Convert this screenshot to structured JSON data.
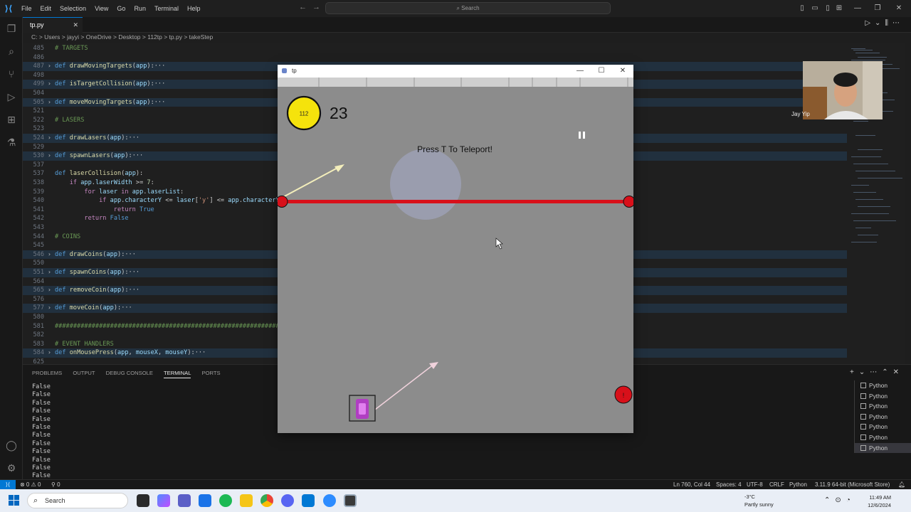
{
  "menu": [
    "File",
    "Edit",
    "Selection",
    "View",
    "Go",
    "Run",
    "Terminal",
    "Help"
  ],
  "search": {
    "label": "Search"
  },
  "tab": {
    "label": "tp.py",
    "close": "✕"
  },
  "breadcrumb": "C: > Users > jayyi > OneDrive > Desktop > 112tp > tp.py > takeStep",
  "code_lines": [
    {
      "ln": "485",
      "html": "<span class='cm'># TARGETS</span>",
      "folded": false
    },
    {
      "ln": "486",
      "html": "",
      "folded": false
    },
    {
      "ln": "487",
      "html": "<span class='kw'>def</span> <span class='fn'>drawMovingTargets</span>(<span class='var'>app</span>):···",
      "folded": true
    },
    {
      "ln": "498",
      "html": "",
      "folded": false
    },
    {
      "ln": "499",
      "html": "<span class='kw'>def</span> <span class='fn'>isTargetCollision</span>(<span class='var'>app</span>):···",
      "folded": true
    },
    {
      "ln": "504",
      "html": "",
      "folded": false
    },
    {
      "ln": "505",
      "html": "<span class='kw'>def</span> <span class='fn'>moveMovingTargets</span>(<span class='var'>app</span>):···",
      "folded": true
    },
    {
      "ln": "521",
      "html": "",
      "folded": false
    },
    {
      "ln": "522",
      "html": "<span class='cm'># LASERS</span>",
      "folded": false
    },
    {
      "ln": "523",
      "html": "",
      "folded": false
    },
    {
      "ln": "524",
      "html": "<span class='kw'>def</span> <span class='fn'>drawLasers</span>(<span class='var'>app</span>):···",
      "folded": true
    },
    {
      "ln": "529",
      "html": "",
      "folded": false
    },
    {
      "ln": "530",
      "html": "<span class='kw'>def</span> <span class='fn'>spawnLasers</span>(<span class='var'>app</span>):···",
      "folded": true
    },
    {
      "ln": "537",
      "html": "",
      "folded": false
    },
    {
      "ln": "537",
      "html": "<span class='kw'>def</span> <span class='fn'>laserCollision</span>(<span class='var'>app</span>):",
      "folded": false
    },
    {
      "ln": "538",
      "html": "    <span class='ctl'>if</span> <span class='var'>app</span>.<span class='var'>laserWidth</span> &gt;= <span class='num'>7</span>:",
      "folded": false
    },
    {
      "ln": "539",
      "html": "        <span class='ctl'>for</span> <span class='var'>laser</span> <span class='ctl'>in</span> <span class='var'>app</span>.<span class='var'>laserList</span>:",
      "folded": false
    },
    {
      "ln": "540",
      "html": "            <span class='ctl'>if</span> <span class='var'>app</span>.<span class='var'>characterY</span> &lt;= <span class='var'>laser</span>[<span class='str'>'y'</span>] &lt;= <span class='var'>app</span>.<span class='var'>characterY</span>",
      "folded": false
    },
    {
      "ln": "541",
      "html": "                <span class='ctl'>return</span> <span class='kw'>True</span>",
      "folded": false
    },
    {
      "ln": "542",
      "html": "        <span class='ctl'>return</span> <span class='kw'>False</span>",
      "folded": false
    },
    {
      "ln": "543",
      "html": "",
      "folded": false
    },
    {
      "ln": "544",
      "html": "<span class='cm'># COINS</span>",
      "folded": false
    },
    {
      "ln": "545",
      "html": "",
      "folded": false
    },
    {
      "ln": "546",
      "html": "<span class='kw'>def</span> <span class='fn'>drawCoins</span>(<span class='var'>app</span>):···",
      "folded": true
    },
    {
      "ln": "550",
      "html": "",
      "folded": false
    },
    {
      "ln": "551",
      "html": "<span class='kw'>def</span> <span class='fn'>spawnCoins</span>(<span class='var'>app</span>):···",
      "folded": true
    },
    {
      "ln": "564",
      "html": "",
      "folded": false
    },
    {
      "ln": "565",
      "html": "<span class='kw'>def</span> <span class='fn'>removeCoin</span>(<span class='var'>app</span>):···",
      "folded": true
    },
    {
      "ln": "576",
      "html": "",
      "folded": false
    },
    {
      "ln": "577",
      "html": "<span class='kw'>def</span> <span class='fn'>moveCoin</span>(<span class='var'>app</span>):···",
      "folded": true
    },
    {
      "ln": "580",
      "html": "",
      "folded": false
    },
    {
      "ln": "581",
      "html": "<span class='cm'>##############################################################</span>",
      "folded": false
    },
    {
      "ln": "582",
      "html": "",
      "folded": false
    },
    {
      "ln": "583",
      "html": "<span class='cm'># EVENT HANDLERS</span>",
      "folded": false
    },
    {
      "ln": "584",
      "html": "<span class='kw'>def</span> <span class='fn'>onMousePress</span>(<span class='var'>app</span>, <span class='var'>mouseX</span>, <span class='var'>mouseY</span>):···",
      "folded": true
    },
    {
      "ln": "625",
      "html": "",
      "folded": false
    }
  ],
  "panel": {
    "tabs": [
      "PROBLEMS",
      "OUTPUT",
      "DEBUG CONSOLE",
      "TERMINAL",
      "PORTS"
    ],
    "active_tab": "TERMINAL",
    "terminal_lines": [
      "False",
      "False",
      "False",
      "False",
      "False",
      "False",
      "False",
      "False",
      "False",
      "False",
      "False",
      "False"
    ],
    "terminals": [
      "Python",
      "Python",
      "Python",
      "Python",
      "Python",
      "Python",
      "Python"
    ]
  },
  "status": {
    "errors": "⊗ 0 ⚠ 0",
    "ports": "⚲ 0",
    "position": "Ln 760, Col 44",
    "spaces": "Spaces: 4",
    "encoding": "UTF-8",
    "eol": "CRLF",
    "language": "Python",
    "interpreter": "3.11.9 64-bit (Microsoft Store)"
  },
  "taskbar": {
    "search": "Search",
    "temp": "-3°C",
    "weather": "Partly sunny",
    "time": "11:49 AM",
    "date": "12/6/2024"
  },
  "tp_window": {
    "title": "tp",
    "game": {
      "coin_count": "112",
      "score": "23",
      "hint": "Press T To Teleport!",
      "laser_y_fraction": 0.333,
      "lives_marker": "!"
    }
  },
  "webcam": {
    "name": "Jay Yip"
  },
  "colors": {
    "accent": "#0078d4",
    "coin": "#f5e30c",
    "laser": "#d8101a",
    "game_bg": "#8c8c8c"
  }
}
